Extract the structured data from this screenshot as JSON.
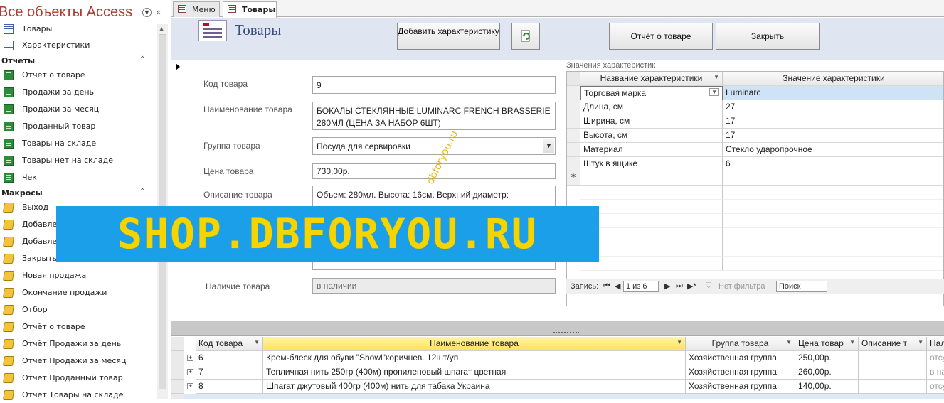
{
  "nav": {
    "title": "Все объекты Access",
    "tables": [
      {
        "label": "Товары",
        "icon": "table-icon"
      },
      {
        "label": "Характеристики",
        "icon": "table-icon"
      }
    ],
    "reports_group": "Отчеты",
    "reports": [
      {
        "label": "Отчёт о товаре",
        "icon": "report-icon"
      },
      {
        "label": "Продажи за день",
        "icon": "report-icon"
      },
      {
        "label": "Продажи за месяц",
        "icon": "report-icon"
      },
      {
        "label": "Проданный товар",
        "icon": "report-icon"
      },
      {
        "label": "Товары на складе",
        "icon": "report-icon"
      },
      {
        "label": "Товары нет на складе",
        "icon": "report-icon"
      },
      {
        "label": "Чек",
        "icon": "report-icon"
      }
    ],
    "macros_group": "Макросы",
    "macros": [
      {
        "label": "Выход",
        "icon": "macro-icon"
      },
      {
        "label": "Добавле",
        "icon": "macro-icon"
      },
      {
        "label": "Добавле",
        "icon": "macro-icon"
      },
      {
        "label": "Закрыть",
        "icon": "macro-icon"
      },
      {
        "label": "Новая продажа",
        "icon": "macro-icon"
      },
      {
        "label": "Окончание продажи",
        "icon": "macro-icon"
      },
      {
        "label": "Отбор",
        "icon": "macro-icon"
      },
      {
        "label": "Отчёт о товаре",
        "icon": "macro-icon"
      },
      {
        "label": "Отчёт Продажи за день",
        "icon": "macro-icon"
      },
      {
        "label": "Отчёт Продажи за месяц",
        "icon": "macro-icon"
      },
      {
        "label": "Отчёт Проданный товар",
        "icon": "macro-icon"
      },
      {
        "label": "Отчёт Товары на складе",
        "icon": "macro-icon"
      }
    ]
  },
  "tabs": [
    {
      "label": "Меню",
      "active": false
    },
    {
      "label": "Товары",
      "active": true
    }
  ],
  "header": {
    "title": "Товары",
    "add_button": "Добавить характеристику",
    "report_button": "Отчёт о товаре",
    "close_button": "Закрыть"
  },
  "form": {
    "code_label": "Код товара",
    "code_value": "9",
    "name_label": "Наименование товара",
    "name_value": "БОКАЛЫ СТЕКЛЯННЫЕ LUMINARC FRENCH BRASSERIE 280МЛ (ЦЕНА ЗА НАБОР 6ШТ)",
    "group_label": "Группа товара",
    "group_value": "Посуда для сервировки",
    "price_label": "Цена товара",
    "price_value": "730,00р.",
    "desc_label": "Описание товара",
    "desc_value": "Объем: 280мл. Высота: 16см. Верхний диаметр:",
    "stock_label": "Наличие товара",
    "stock_value": "в наличии"
  },
  "subform": {
    "caption": "Значения характеристик",
    "columns": [
      "Название характеристики",
      "Значение характеристики"
    ],
    "rows": [
      {
        "name": "Торговая марка",
        "value": "Luminarc"
      },
      {
        "name": "Длина, см",
        "value": "27"
      },
      {
        "name": "Ширина, см",
        "value": "17"
      },
      {
        "name": "Высота, см",
        "value": "17"
      },
      {
        "name": "Материал",
        "value": "Стекло ударопрочное"
      },
      {
        "name": "Штук в ящике",
        "value": "6"
      }
    ],
    "new_row_marker": "*",
    "nav": {
      "label": "Запись:",
      "position": "1 из 6",
      "filter": "Нет фильтра",
      "search": "Поиск"
    }
  },
  "datasheet": {
    "columns": [
      "Код товара",
      "Наименование товара",
      "Группа товара",
      "Цена товар",
      "Описание т",
      "Нал"
    ],
    "rows": [
      {
        "code": "6",
        "name": "Крем-блеск для обуви \"Showl\"коричнев. 12шт/уп",
        "group": "Хозяйственная группа",
        "price": "250,00р.",
        "desc": "",
        "stock": "отсу"
      },
      {
        "code": "7",
        "name": "Тепличная нить 250гр (400м) пропиленовый шпагат цветная",
        "group": "Хозяйственная группа",
        "price": "260,00р.",
        "desc": "",
        "stock": "в на"
      },
      {
        "code": "8",
        "name": "Шпагат джутовый 400гр (400м) нить для табака Украина",
        "group": "Хозяйственная группа",
        "price": "140,00р.",
        "desc": "",
        "stock": "отсу"
      }
    ]
  },
  "watermark": {
    "banner": "SHOP.DBFORYOU.RU",
    "diagonal": "dbforyou.ru"
  },
  "colors": {
    "banner_bg": "#1b9fe8",
    "banner_text": "#f6d400",
    "nav_title": "#b03a2e",
    "header_bg": "#dfe6f2"
  }
}
